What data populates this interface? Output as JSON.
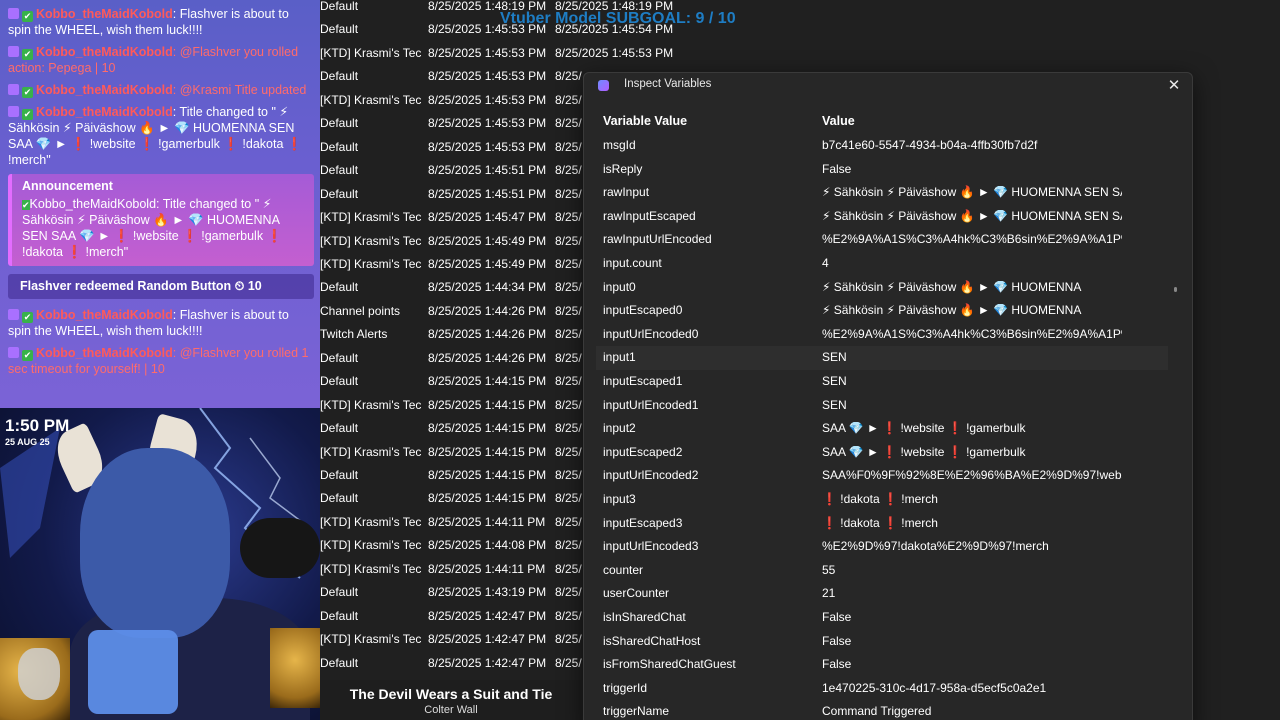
{
  "chat": {
    "messages": [
      {
        "user": "Kobbo_theMaidKobold",
        "text": ": Flashver is about to spin the WHEEL, wish them luck!!!!",
        "text_style": "white"
      },
      {
        "user": "Kobbo_theMaidKobold",
        "text": ": @Flashver you rolled action: Pepega | 10",
        "text_style": "red"
      },
      {
        "user": "Kobbo_theMaidKobold",
        "text": ": @Krasmi Title updated",
        "text_style": "red"
      },
      {
        "user": "Kobbo_theMaidKobold",
        "text": ": Title changed to \" ⚡ Sähkösin ⚡ Päiväshow 🔥 ► 💎 HUOMENNA SEN SAA 💎 ► ❗ !website ❗ !gamerbulk ❗ !dakota ❗ !merch\"",
        "text_style": "white"
      }
    ],
    "announcement": {
      "title": "Announcement",
      "user": "Kobbo_theMaidKobold",
      "text": ": Title changed to \" ⚡ Sähkösin ⚡ Päiväshow 🔥 ► 💎 HUOMENNA SEN SAA 💎 ► ❗ !website ❗ !gamerbulk ❗ !dakota ❗ !merch\""
    },
    "redeem": "Flashver redeemed Random Button ⏲ 10",
    "messages2": [
      {
        "user": "Kobbo_theMaidKobold",
        "text": ": Flashver is about to spin the WHEEL, wish them luck!!!!",
        "text_style": "white"
      },
      {
        "user": "Kobbo_theMaidKobold",
        "text": ": @Flashver you rolled 1 sec timeout for yourself! | 10",
        "text_style": "red"
      }
    ]
  },
  "cam": {
    "time": "1:50 PM",
    "date": "25 AUG 25"
  },
  "now_playing": {
    "title": "The Devil Wears a Suit and Tie",
    "artist": "Colter Wall"
  },
  "subgoal": "Vtuber Model SUBGOAL: 9 / 10",
  "log_rows": [
    {
      "type": "Default",
      "t1": "8/25/2025 1:48:19 PM",
      "t2": "8/25/2025 1:48:19 PM"
    },
    {
      "type": "Default",
      "t1": "8/25/2025 1:45:53 PM",
      "t2": "8/25/2025 1:45:54 PM"
    },
    {
      "type": "[KTD] Krasmi's Tec",
      "t1": "8/25/2025 1:45:53 PM",
      "t2": "8/25/2025 1:45:53 PM"
    },
    {
      "type": "Default",
      "t1": "8/25/2025 1:45:53 PM",
      "t2": "8/25/"
    },
    {
      "type": "[KTD] Krasmi's Tec",
      "t1": "8/25/2025 1:45:53 PM",
      "t2": "8/25/"
    },
    {
      "type": "Default",
      "t1": "8/25/2025 1:45:53 PM",
      "t2": "8/25/"
    },
    {
      "type": "Default",
      "t1": "8/25/2025 1:45:53 PM",
      "t2": "8/25/"
    },
    {
      "type": "Default",
      "t1": "8/25/2025 1:45:51 PM",
      "t2": "8/25/"
    },
    {
      "type": "Default",
      "t1": "8/25/2025 1:45:51 PM",
      "t2": "8/25/"
    },
    {
      "type": "[KTD] Krasmi's Tec",
      "t1": "8/25/2025 1:45:47 PM",
      "t2": "8/25/"
    },
    {
      "type": "[KTD] Krasmi's Tec",
      "t1": "8/25/2025 1:45:49 PM",
      "t2": "8/25/"
    },
    {
      "type": "[KTD] Krasmi's Tec",
      "t1": "8/25/2025 1:45:49 PM",
      "t2": "8/25/"
    },
    {
      "type": "Default",
      "t1": "8/25/2025 1:44:34 PM",
      "t2": "8/25/"
    },
    {
      "type": "Channel points",
      "t1": "8/25/2025 1:44:26 PM",
      "t2": "8/25/"
    },
    {
      "type": "Twitch Alerts",
      "t1": "8/25/2025 1:44:26 PM",
      "t2": "8/25/"
    },
    {
      "type": "Default",
      "t1": "8/25/2025 1:44:26 PM",
      "t2": "8/25/"
    },
    {
      "type": "Default",
      "t1": "8/25/2025 1:44:15 PM",
      "t2": "8/25/"
    },
    {
      "type": "[KTD] Krasmi's Tec",
      "t1": "8/25/2025 1:44:15 PM",
      "t2": "8/25/"
    },
    {
      "type": "Default",
      "t1": "8/25/2025 1:44:15 PM",
      "t2": "8/25/"
    },
    {
      "type": "[KTD] Krasmi's Tec",
      "t1": "8/25/2025 1:44:15 PM",
      "t2": "8/25/"
    },
    {
      "type": "Default",
      "t1": "8/25/2025 1:44:15 PM",
      "t2": "8/25/"
    },
    {
      "type": "Default",
      "t1": "8/25/2025 1:44:15 PM",
      "t2": "8/25/"
    },
    {
      "type": "[KTD] Krasmi's Tec",
      "t1": "8/25/2025 1:44:11 PM",
      "t2": "8/25/"
    },
    {
      "type": "[KTD] Krasmi's Tec",
      "t1": "8/25/2025 1:44:08 PM",
      "t2": "8/25/"
    },
    {
      "type": "[KTD] Krasmi's Tec",
      "t1": "8/25/2025 1:44:11 PM",
      "t2": "8/25/"
    },
    {
      "type": "Default",
      "t1": "8/25/2025 1:43:19 PM",
      "t2": "8/25/"
    },
    {
      "type": "Default",
      "t1": "8/25/2025 1:42:47 PM",
      "t2": "8/25/"
    },
    {
      "type": "[KTD] Krasmi's Tec",
      "t1": "8/25/2025 1:42:47 PM",
      "t2": "8/25/"
    },
    {
      "type": "Default",
      "t1": "8/25/2025 1:42:47 PM",
      "t2": "8/25/"
    }
  ],
  "dialog": {
    "title": "Inspect Variables",
    "close_glyph": "✕",
    "col_variable": "Variable Value",
    "col_value": "Value",
    "rows": [
      {
        "name": "msgId",
        "value": "b7c41e60-5547-4934-b04a-4ffb30fb7d2f"
      },
      {
        "name": "isReply",
        "value": "False"
      },
      {
        "name": "rawInput",
        "value": "⚡ Sähkösin ⚡ Päiväshow 🔥 ► 💎 HUOMENNA SEN SA"
      },
      {
        "name": "rawInputEscaped",
        "value": "⚡ Sähkösin ⚡ Päiväshow 🔥 ► 💎 HUOMENNA SEN SA"
      },
      {
        "name": "rawInputUrlEncoded",
        "value": "%E2%9A%A1S%C3%A4hk%C3%B6sin%E2%9A%A1P%C"
      },
      {
        "name": "input.count",
        "value": "4"
      },
      {
        "name": "input0",
        "value": "⚡ Sähkösin ⚡ Päiväshow 🔥 ► 💎 HUOMENNA"
      },
      {
        "name": "inputEscaped0",
        "value": "⚡ Sähkösin ⚡ Päiväshow 🔥 ► 💎 HUOMENNA"
      },
      {
        "name": "inputUrlEncoded0",
        "value": "%E2%9A%A1S%C3%A4hk%C3%B6sin%E2%9A%A1P%C"
      },
      {
        "name": "input1",
        "value": "SEN"
      },
      {
        "name": "inputEscaped1",
        "value": "SEN"
      },
      {
        "name": "inputUrlEncoded1",
        "value": "SEN"
      },
      {
        "name": "input2",
        "value": "SAA 💎 ► ❗ !website ❗ !gamerbulk"
      },
      {
        "name": "inputEscaped2",
        "value": "SAA 💎 ► ❗ !website ❗ !gamerbulk"
      },
      {
        "name": "inputUrlEncoded2",
        "value": "SAA%F0%9F%92%8E%E2%96%BA%E2%9D%97!websit"
      },
      {
        "name": "input3",
        "value": "❗ !dakota ❗ !merch"
      },
      {
        "name": "inputEscaped3",
        "value": "❗ !dakota ❗ !merch"
      },
      {
        "name": "inputUrlEncoded3",
        "value": "%E2%9D%97!dakota%E2%9D%97!merch"
      },
      {
        "name": "counter",
        "value": "55"
      },
      {
        "name": "userCounter",
        "value": "21"
      },
      {
        "name": "isInSharedChat",
        "value": "False"
      },
      {
        "name": "isSharedChatHost",
        "value": "False"
      },
      {
        "name": "isFromSharedChatGuest",
        "value": "False"
      },
      {
        "name": "triggerId",
        "value": "1e470225-310c-4d17-958a-d5ecf5c0a2e1"
      },
      {
        "name": "triggerName",
        "value": "Command Triggered"
      }
    ]
  }
}
